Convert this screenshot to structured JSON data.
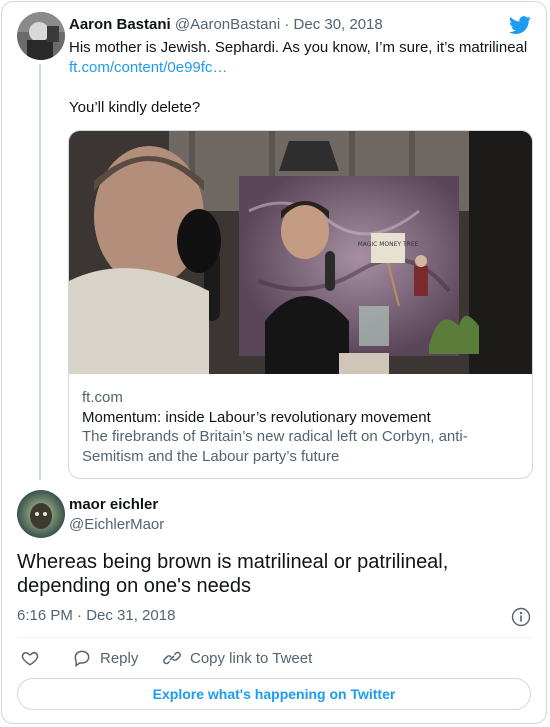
{
  "quoted_tweet": {
    "author_name": "Aaron Bastani",
    "author_handle": "@AaronBastani",
    "separator": "·",
    "date": "Dec 30, 2018",
    "text_line": "His mother is Jewish. Sephardi. As you know, I’m sure, it’s matrilineal",
    "link_text": "ft.com/content/0e99fc…",
    "text_followup": "You’ll kindly delete?",
    "link_card": {
      "domain": "ft.com",
      "title": "Momentum: inside Labour’s revolutionary movement",
      "description": "The firebrands of Britain’s new radical left on Corbyn, anti-Semitism and the Labour party’s future",
      "image_sign_text": "MAGIC MONEY TREE"
    }
  },
  "reply_tweet": {
    "author_name": "maor eichler",
    "author_handle": "@EichlerMaor",
    "text": "Whereas being brown is matrilineal or patrilineal, depending on one's needs",
    "timestamp": "6:16 PM · Dec 31, 2018"
  },
  "actions": {
    "reply_label": "Reply",
    "copy_link_label": "Copy link to Tweet"
  },
  "explore_label": "Explore what's happening on Twitter",
  "colors": {
    "link": "#1d9bf0",
    "secondary_text": "#536471",
    "border": "#cfd9de",
    "like_heart": "#536471"
  },
  "icons": [
    "twitter-bird-icon",
    "info-icon",
    "heart-icon",
    "reply-bubble-icon",
    "link-icon"
  ]
}
